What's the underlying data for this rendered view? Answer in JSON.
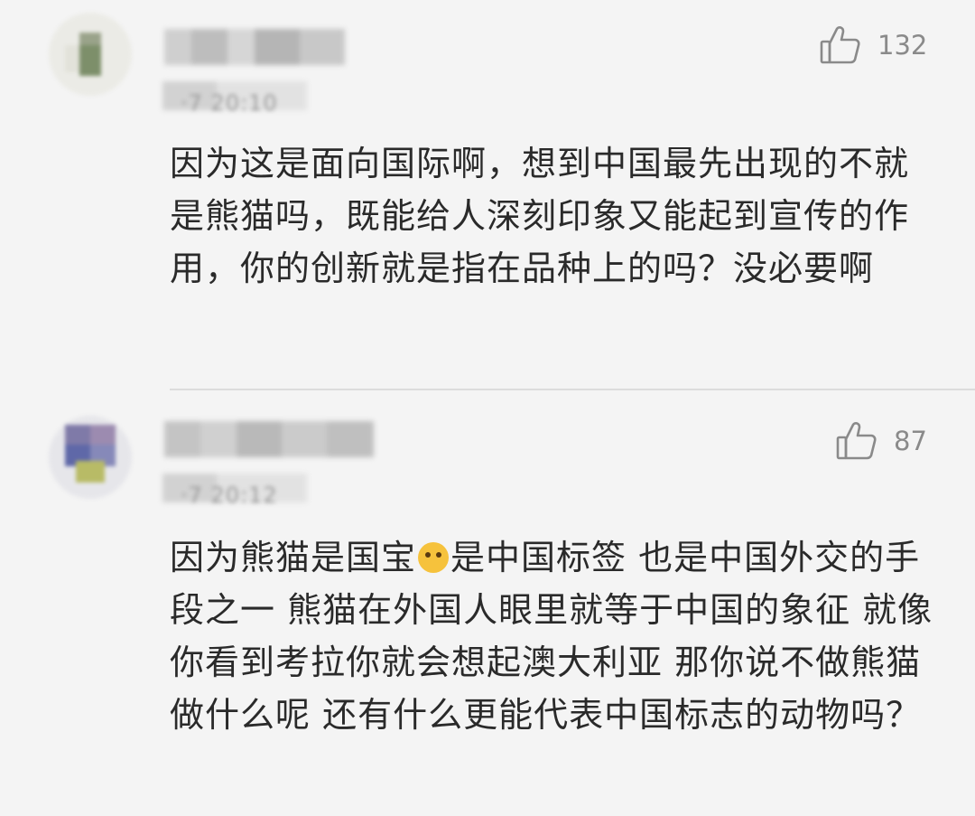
{
  "comments": [
    {
      "username": "",
      "timestamp": "·7 20:10",
      "likes": "132",
      "text": "因为这是面向国际啊，想到中国最先出现的不就是熊猫吗，既能给人深刻印象又能起到宣传的作用，你的创新就是指在品种上的吗？没必要啊"
    },
    {
      "username": "",
      "timestamp": "·7 20:12",
      "likes": "87",
      "text_before_emoji": "因为熊猫是国宝",
      "emoji": "doge-emoji",
      "text_after_emoji": "是中国标签 也是中国外交的手段之一 熊猫在外国人眼里就等于中国的象征 就像你看到考拉你就会想起澳大利亚 那你说不做熊猫做什么呢 还有什么更能代表中国标志的动物吗？"
    }
  ],
  "icons": {
    "like": "thumbs-up-icon"
  },
  "colors": {
    "background": "#f4f4f4",
    "text": "#2a2a2a",
    "meta": "#8a8a8a",
    "divider": "#dcdcdc"
  }
}
